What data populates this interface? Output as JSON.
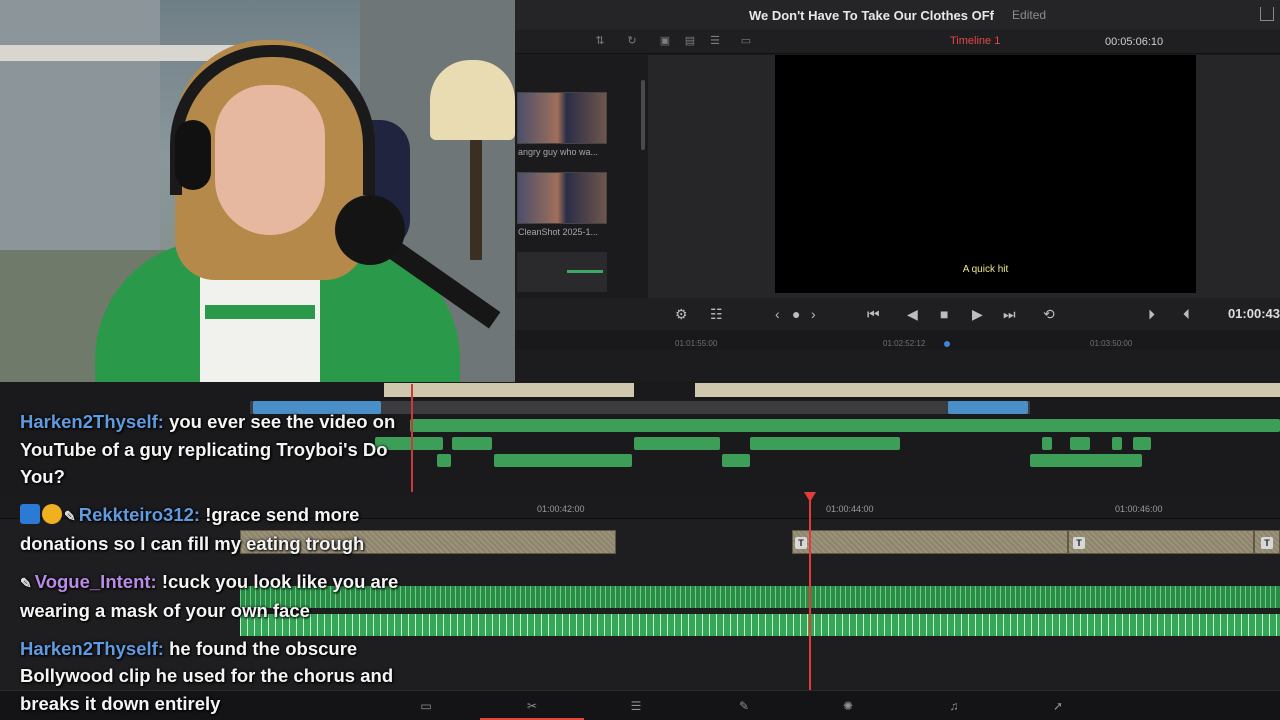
{
  "resolve": {
    "project_title": "We Don't Have To Take Our Clothes OFf",
    "status": "Edited",
    "timeline_name": "Timeline 1",
    "timecode_top": "00:05:06:10",
    "viewer_timecode": "01:00:43",
    "subtitle_text": "A quick hit",
    "media_pool": [
      {
        "label": "angry guy who wa..."
      },
      {
        "label": "CleanShot 2025-1..."
      }
    ],
    "overview_ruler": [
      "01:01:55:00",
      "01:02:52:12",
      "01:03:50:00"
    ],
    "ruler_labels": [
      "01:00:42:00",
      "01:00:44:00",
      "01:00:46:00"
    ],
    "text_clip_mark": "T",
    "icons": [
      "share-icon",
      "sort-icon",
      "refresh-icon",
      "grid-icon",
      "list-icon",
      "prev-icon",
      "next-icon",
      "jump-start-icon",
      "step-back-icon",
      "stop-icon",
      "play-icon",
      "jump-end-icon",
      "loop-icon"
    ],
    "accent_color": "#e04848"
  },
  "chat": [
    {
      "user": "Harken2Thyself:",
      "text": " you ever see the video on YouTube of a guy replicating Troyboi's Do You?",
      "color": "#5f9be0"
    },
    {
      "user": "Rekkteiro312:",
      "text": " !grace send more donations so I can fill my eating trough",
      "color": "#5f9be0"
    },
    {
      "user": "Vogue_Intent:",
      "text": " !cuck you look like you are wearing a mask of your own face",
      "color": "#b98be6"
    },
    {
      "user": "Harken2Thyself:",
      "text": " he found the obscure Bollywood clip he used for the chorus and breaks it down entirely",
      "color": "#5f9be0"
    }
  ]
}
